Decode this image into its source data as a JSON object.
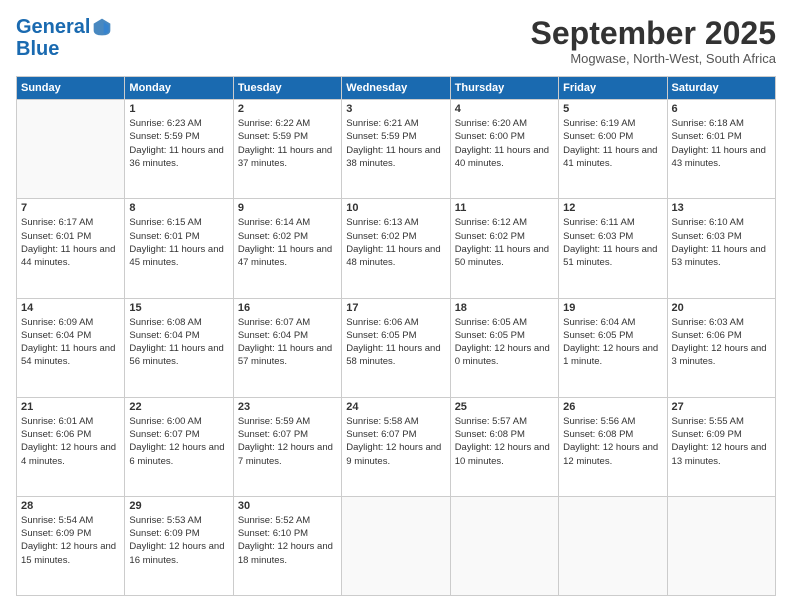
{
  "logo": {
    "line1": "General",
    "line2": "Blue"
  },
  "title": "September 2025",
  "location": "Mogwase, North-West, South Africa",
  "headers": [
    "Sunday",
    "Monday",
    "Tuesday",
    "Wednesday",
    "Thursday",
    "Friday",
    "Saturday"
  ],
  "weeks": [
    [
      {
        "day": "",
        "sunrise": "",
        "sunset": "",
        "daylight": ""
      },
      {
        "day": "1",
        "sunrise": "Sunrise: 6:23 AM",
        "sunset": "Sunset: 5:59 PM",
        "daylight": "Daylight: 11 hours and 36 minutes."
      },
      {
        "day": "2",
        "sunrise": "Sunrise: 6:22 AM",
        "sunset": "Sunset: 5:59 PM",
        "daylight": "Daylight: 11 hours and 37 minutes."
      },
      {
        "day": "3",
        "sunrise": "Sunrise: 6:21 AM",
        "sunset": "Sunset: 5:59 PM",
        "daylight": "Daylight: 11 hours and 38 minutes."
      },
      {
        "day": "4",
        "sunrise": "Sunrise: 6:20 AM",
        "sunset": "Sunset: 6:00 PM",
        "daylight": "Daylight: 11 hours and 40 minutes."
      },
      {
        "day": "5",
        "sunrise": "Sunrise: 6:19 AM",
        "sunset": "Sunset: 6:00 PM",
        "daylight": "Daylight: 11 hours and 41 minutes."
      },
      {
        "day": "6",
        "sunrise": "Sunrise: 6:18 AM",
        "sunset": "Sunset: 6:01 PM",
        "daylight": "Daylight: 11 hours and 43 minutes."
      }
    ],
    [
      {
        "day": "7",
        "sunrise": "Sunrise: 6:17 AM",
        "sunset": "Sunset: 6:01 PM",
        "daylight": "Daylight: 11 hours and 44 minutes."
      },
      {
        "day": "8",
        "sunrise": "Sunrise: 6:15 AM",
        "sunset": "Sunset: 6:01 PM",
        "daylight": "Daylight: 11 hours and 45 minutes."
      },
      {
        "day": "9",
        "sunrise": "Sunrise: 6:14 AM",
        "sunset": "Sunset: 6:02 PM",
        "daylight": "Daylight: 11 hours and 47 minutes."
      },
      {
        "day": "10",
        "sunrise": "Sunrise: 6:13 AM",
        "sunset": "Sunset: 6:02 PM",
        "daylight": "Daylight: 11 hours and 48 minutes."
      },
      {
        "day": "11",
        "sunrise": "Sunrise: 6:12 AM",
        "sunset": "Sunset: 6:02 PM",
        "daylight": "Daylight: 11 hours and 50 minutes."
      },
      {
        "day": "12",
        "sunrise": "Sunrise: 6:11 AM",
        "sunset": "Sunset: 6:03 PM",
        "daylight": "Daylight: 11 hours and 51 minutes."
      },
      {
        "day": "13",
        "sunrise": "Sunrise: 6:10 AM",
        "sunset": "Sunset: 6:03 PM",
        "daylight": "Daylight: 11 hours and 53 minutes."
      }
    ],
    [
      {
        "day": "14",
        "sunrise": "Sunrise: 6:09 AM",
        "sunset": "Sunset: 6:04 PM",
        "daylight": "Daylight: 11 hours and 54 minutes."
      },
      {
        "day": "15",
        "sunrise": "Sunrise: 6:08 AM",
        "sunset": "Sunset: 6:04 PM",
        "daylight": "Daylight: 11 hours and 56 minutes."
      },
      {
        "day": "16",
        "sunrise": "Sunrise: 6:07 AM",
        "sunset": "Sunset: 6:04 PM",
        "daylight": "Daylight: 11 hours and 57 minutes."
      },
      {
        "day": "17",
        "sunrise": "Sunrise: 6:06 AM",
        "sunset": "Sunset: 6:05 PM",
        "daylight": "Daylight: 11 hours and 58 minutes."
      },
      {
        "day": "18",
        "sunrise": "Sunrise: 6:05 AM",
        "sunset": "Sunset: 6:05 PM",
        "daylight": "Daylight: 12 hours and 0 minutes."
      },
      {
        "day": "19",
        "sunrise": "Sunrise: 6:04 AM",
        "sunset": "Sunset: 6:05 PM",
        "daylight": "Daylight: 12 hours and 1 minute."
      },
      {
        "day": "20",
        "sunrise": "Sunrise: 6:03 AM",
        "sunset": "Sunset: 6:06 PM",
        "daylight": "Daylight: 12 hours and 3 minutes."
      }
    ],
    [
      {
        "day": "21",
        "sunrise": "Sunrise: 6:01 AM",
        "sunset": "Sunset: 6:06 PM",
        "daylight": "Daylight: 12 hours and 4 minutes."
      },
      {
        "day": "22",
        "sunrise": "Sunrise: 6:00 AM",
        "sunset": "Sunset: 6:07 PM",
        "daylight": "Daylight: 12 hours and 6 minutes."
      },
      {
        "day": "23",
        "sunrise": "Sunrise: 5:59 AM",
        "sunset": "Sunset: 6:07 PM",
        "daylight": "Daylight: 12 hours and 7 minutes."
      },
      {
        "day": "24",
        "sunrise": "Sunrise: 5:58 AM",
        "sunset": "Sunset: 6:07 PM",
        "daylight": "Daylight: 12 hours and 9 minutes."
      },
      {
        "day": "25",
        "sunrise": "Sunrise: 5:57 AM",
        "sunset": "Sunset: 6:08 PM",
        "daylight": "Daylight: 12 hours and 10 minutes."
      },
      {
        "day": "26",
        "sunrise": "Sunrise: 5:56 AM",
        "sunset": "Sunset: 6:08 PM",
        "daylight": "Daylight: 12 hours and 12 minutes."
      },
      {
        "day": "27",
        "sunrise": "Sunrise: 5:55 AM",
        "sunset": "Sunset: 6:09 PM",
        "daylight": "Daylight: 12 hours and 13 minutes."
      }
    ],
    [
      {
        "day": "28",
        "sunrise": "Sunrise: 5:54 AM",
        "sunset": "Sunset: 6:09 PM",
        "daylight": "Daylight: 12 hours and 15 minutes."
      },
      {
        "day": "29",
        "sunrise": "Sunrise: 5:53 AM",
        "sunset": "Sunset: 6:09 PM",
        "daylight": "Daylight: 12 hours and 16 minutes."
      },
      {
        "day": "30",
        "sunrise": "Sunrise: 5:52 AM",
        "sunset": "Sunset: 6:10 PM",
        "daylight": "Daylight: 12 hours and 18 minutes."
      },
      {
        "day": "",
        "sunrise": "",
        "sunset": "",
        "daylight": ""
      },
      {
        "day": "",
        "sunrise": "",
        "sunset": "",
        "daylight": ""
      },
      {
        "day": "",
        "sunrise": "",
        "sunset": "",
        "daylight": ""
      },
      {
        "day": "",
        "sunrise": "",
        "sunset": "",
        "daylight": ""
      }
    ]
  ]
}
